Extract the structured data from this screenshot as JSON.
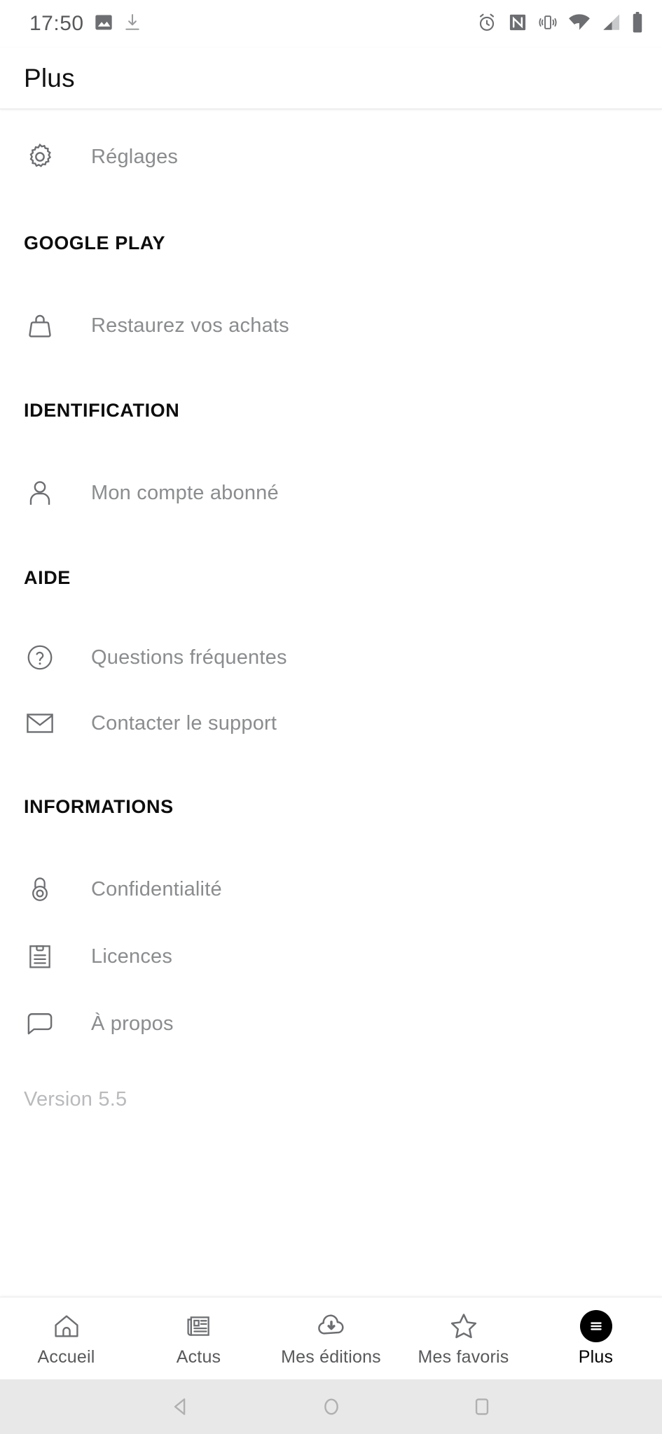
{
  "statusbar": {
    "clock": "17:50",
    "left_icons": [
      "image-icon",
      "download-icon"
    ],
    "right_icons": [
      "alarm-icon",
      "nfc-icon",
      "vibrate-icon",
      "wifi-icon",
      "signal-icon",
      "battery-icon"
    ]
  },
  "toolbar": {
    "title": "Plus"
  },
  "colors": {
    "label": "#8a8c8e",
    "heading": "#0d0d0d",
    "icon": "#6d6e71",
    "accent": "#000000",
    "background": "#ffffff",
    "sysbar": "#e8e8e8"
  },
  "menu": {
    "top_items": [
      {
        "label": "Réglages",
        "icon": "gear-icon",
        "name": "settings"
      }
    ],
    "sections": [
      {
        "title": "GOOGLE PLAY",
        "items": [
          {
            "label": "Restaurez vos achats",
            "icon": "bag-icon",
            "name": "restore-purchases"
          }
        ]
      },
      {
        "title": "IDENTIFICATION",
        "items": [
          {
            "label": "Mon compte abonné",
            "icon": "person-icon",
            "name": "subscriber-account"
          }
        ]
      },
      {
        "title": "AIDE",
        "items": [
          {
            "label": "Questions fréquentes",
            "icon": "question-circle-icon",
            "name": "faq"
          },
          {
            "label": "Contacter le support",
            "icon": "envelope-icon",
            "name": "contact-support"
          }
        ]
      },
      {
        "title": "INFORMATIONS",
        "items": [
          {
            "label": "Confidentialité",
            "icon": "lock-icon",
            "name": "privacy"
          },
          {
            "label": "Licences",
            "icon": "clipboard-icon",
            "name": "licenses"
          },
          {
            "label": "À propos",
            "icon": "speech-bubble-icon",
            "name": "about"
          }
        ]
      }
    ],
    "version": "Version 5.5"
  },
  "bottomnav": {
    "items": [
      {
        "label": "Accueil",
        "icon": "home-icon",
        "name": "accueil",
        "active": false
      },
      {
        "label": "Actus",
        "icon": "newspaper-icon",
        "name": "actus",
        "active": false
      },
      {
        "label": "Mes éditions",
        "icon": "cloud-download-icon",
        "name": "mes-editions",
        "active": false
      },
      {
        "label": "Mes favoris",
        "icon": "star-icon",
        "name": "mes-favoris",
        "active": false
      },
      {
        "label": "Plus",
        "icon": "hamburger-icon",
        "name": "plus",
        "active": true
      }
    ]
  },
  "sysbar": {
    "buttons": [
      "back-icon",
      "home-icon",
      "recents-icon"
    ]
  }
}
